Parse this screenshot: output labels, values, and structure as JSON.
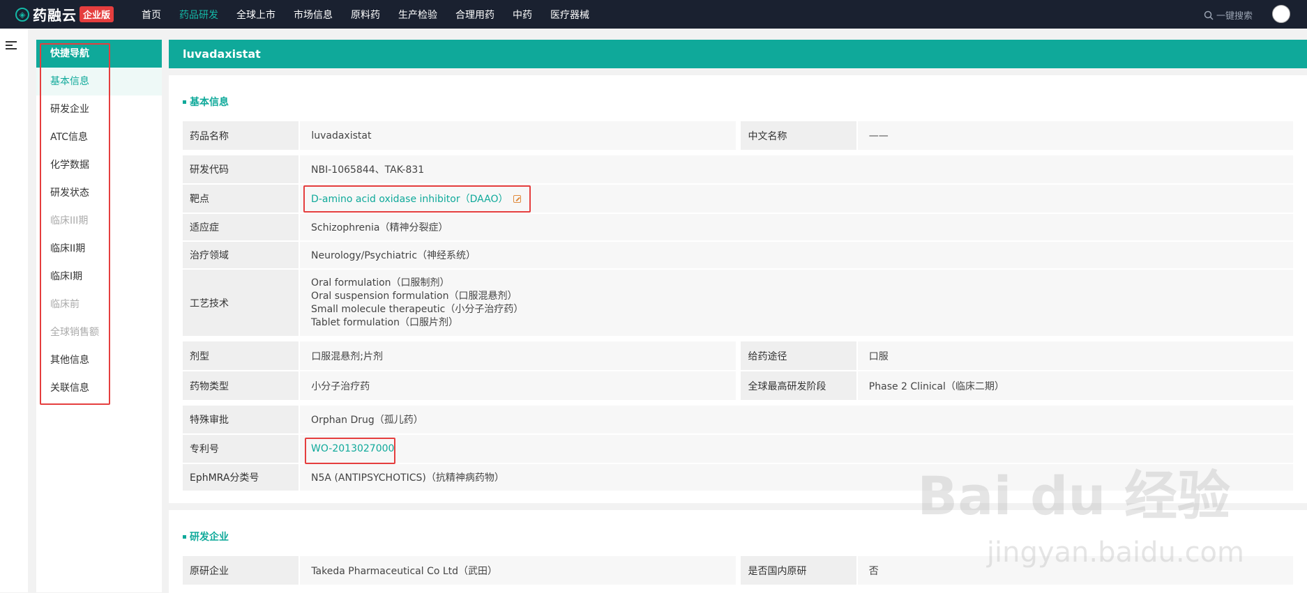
{
  "app": {
    "logo_text": "药融云",
    "logo_badge": "企业版",
    "nav": [
      {
        "label": "首页"
      },
      {
        "label": "药品研发"
      },
      {
        "label": "全球上市"
      },
      {
        "label": "市场信息"
      },
      {
        "label": "原料药"
      },
      {
        "label": "生产检验"
      },
      {
        "label": "合理用药"
      },
      {
        "label": "中药"
      },
      {
        "label": "医疗器械"
      }
    ],
    "search_label": "一键搜索",
    "active_color": "#0fa99a",
    "topbar_color": "#1a2130"
  },
  "quicknav": {
    "header": "快捷导航",
    "items": [
      {
        "label": "基本信息"
      },
      {
        "label": "研发企业"
      },
      {
        "label": "ATC信息"
      },
      {
        "label": "化学数据"
      },
      {
        "label": "研发状态"
      },
      {
        "label": "临床III期"
      },
      {
        "label": "临床II期"
      },
      {
        "label": "临床I期"
      },
      {
        "label": "临床前"
      },
      {
        "label": "全球销售额"
      },
      {
        "label": "其他信息"
      },
      {
        "label": "关联信息"
      }
    ]
  },
  "drug": {
    "title": "luvadaxistat",
    "basic_section": "基本信息",
    "name_label": "药品名称",
    "name_value": "luvadaxistat",
    "cn_name_label": "中文名称",
    "cn_name_value": "——",
    "code_label": "研发代码",
    "code_value": "NBI-1065844、TAK-831",
    "target_label": "靶点",
    "target_value": "D-amino acid oxidase inhibitor（DAAO）",
    "indication_label": "适应症",
    "indication_value": "Schizophrenia（精神分裂症）",
    "area_label": "治疗领域",
    "area_value": "Neurology/Psychiatric（神经系统）",
    "tech_label": "工艺技术",
    "tech_values": [
      "Oral formulation（口服制剂）",
      "Oral suspension formulation（口服混悬剂）",
      "Small molecule therapeutic（小分子治疗药）",
      "Tablet formulation（口服片剂）"
    ],
    "dosage_label": "剂型",
    "dosage_value": "口服混悬剂;片剂",
    "route_label": "给药途径",
    "route_value": "口服",
    "type_label": "药物类型",
    "type_value": "小分子治疗药",
    "stage_label": "全球最高研发阶段",
    "stage_value": "Phase 2 Clinical（临床二期）",
    "special_label": "特殊审批",
    "special_value": "Orphan Drug（孤儿药）",
    "patent_label": "专利号",
    "patent_value": "WO-2013027000",
    "ephmra_label": "EphMRA分类号",
    "ephmra_value": "N5A (ANTIPSYCHOTICS)（抗精神病药物）",
    "company_section": "研发企业",
    "orig_label": "原研企业",
    "orig_value": "Takeda Pharmaceutical Co Ltd（武田）",
    "domestic_label": "是否国内原研",
    "domestic_value": "否"
  },
  "watermark": {
    "text": "Bai du 经验",
    "sub": "jingyan.baidu.com"
  }
}
